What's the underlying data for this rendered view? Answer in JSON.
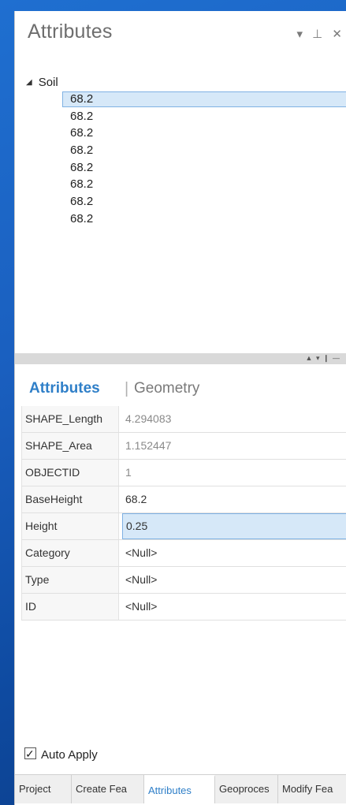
{
  "pane": {
    "title": "Attributes",
    "controls": {
      "dropdown": "▾",
      "pin": "⊥",
      "close": "✕"
    }
  },
  "tree": {
    "root_label": "Soil",
    "items": [
      "68.2",
      "68.2",
      "68.2",
      "68.2",
      "68.2",
      "68.2",
      "68.2",
      "68.2"
    ],
    "selected_index": 0
  },
  "splitter": {
    "controls": "▲ ▾ ❙ —"
  },
  "detail_tabs": {
    "attributes": "Attributes",
    "separator": "|",
    "geometry": "Geometry"
  },
  "fields": [
    {
      "name": "SHAPE_Length",
      "value": "4.294083",
      "readonly": true
    },
    {
      "name": "SHAPE_Area",
      "value": "1.152447",
      "readonly": true
    },
    {
      "name": "OBJECTID",
      "value": "1",
      "readonly": true
    },
    {
      "name": "BaseHeight",
      "value": "68.2",
      "readonly": false
    },
    {
      "name": "Height",
      "value": "0.25",
      "readonly": false,
      "selected": true
    },
    {
      "name": "Category",
      "value": "<Null>",
      "readonly": false
    },
    {
      "name": "Type",
      "value": "<Null>",
      "readonly": false
    },
    {
      "name": "ID",
      "value": "<Null>",
      "readonly": false
    }
  ],
  "auto_apply": {
    "label": "Auto Apply",
    "checked": true
  },
  "bottom_tabs": [
    "Project",
    "Create Fea",
    "Attributes",
    "Geoproces",
    "Modify Fea"
  ],
  "colors": {
    "accent": "#2f7fc8",
    "selection": "#d6e8f8",
    "desktop": "#1a5fbf"
  }
}
